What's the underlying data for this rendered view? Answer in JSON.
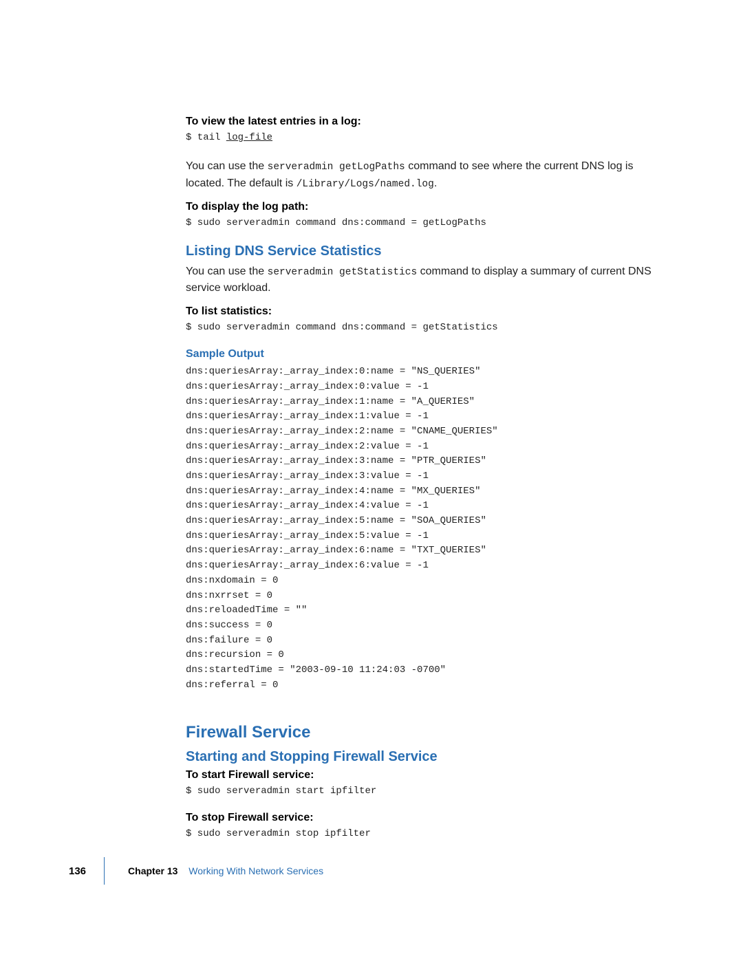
{
  "headings": {
    "view_log": "To view the latest entries in a log:",
    "display_log_path": "To display the log path:",
    "listing_stats": "Listing DNS Service Statistics",
    "to_list_stats": "To list statistics:",
    "sample_output": "Sample Output",
    "firewall_service": "Firewall Service",
    "start_stop_firewall": "Starting and Stopping Firewall Service",
    "to_start_firewall": "To start Firewall service:",
    "to_stop_firewall": "To stop Firewall service:"
  },
  "code": {
    "tail_prefix": "$ tail ",
    "tail_arg": "log-file",
    "getLogPaths": "$ sudo serveradmin command dns:command = getLogPaths",
    "getStatistics": "$ sudo serveradmin command dns:command = getStatistics",
    "start_ipfilter": "$ sudo serveradmin start ipfilter",
    "stop_ipfilter": "$ sudo serveradmin stop ipfilter"
  },
  "para": {
    "p1_a": "You can use the ",
    "p1_code": "serveradmin getLogPaths",
    "p1_b": " command to see where the current DNS log is located. The default is ",
    "p1_code2": "/Library/Logs/named.log",
    "p1_c": ".",
    "p2_a": "You can use the ",
    "p2_code": "serveradmin getStatistics",
    "p2_b": " command to display a summary of current DNS service workload."
  },
  "sample_output_lines": [
    "dns:queriesArray:_array_index:0:name = \"NS_QUERIES\"",
    "dns:queriesArray:_array_index:0:value = -1",
    "dns:queriesArray:_array_index:1:name = \"A_QUERIES\"",
    "dns:queriesArray:_array_index:1:value = -1",
    "dns:queriesArray:_array_index:2:name = \"CNAME_QUERIES\"",
    "dns:queriesArray:_array_index:2:value = -1",
    "dns:queriesArray:_array_index:3:name = \"PTR_QUERIES\"",
    "dns:queriesArray:_array_index:3:value = -1",
    "dns:queriesArray:_array_index:4:name = \"MX_QUERIES\"",
    "dns:queriesArray:_array_index:4:value = -1",
    "dns:queriesArray:_array_index:5:name = \"SOA_QUERIES\"",
    "dns:queriesArray:_array_index:5:value = -1",
    "dns:queriesArray:_array_index:6:name = \"TXT_QUERIES\"",
    "dns:queriesArray:_array_index:6:value = -1",
    "dns:nxdomain = 0",
    "dns:nxrrset = 0",
    "dns:reloadedTime = \"\"",
    "dns:success = 0",
    "dns:failure = 0",
    "dns:recursion = 0",
    "dns:startedTime = \"2003-09-10 11:24:03 -0700\"",
    "dns:referral = 0"
  ],
  "footer": {
    "page": "136",
    "chapter_label": "Chapter 13",
    "chapter_title": "Working With Network Services"
  }
}
